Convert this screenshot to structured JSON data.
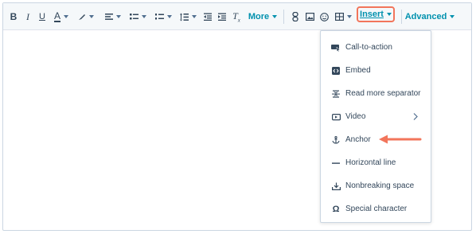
{
  "toolbar": {
    "bold_label": "B",
    "italic_label": "I",
    "underline_label": "U",
    "font_color_label": "A",
    "more_label": "More",
    "insert_label": "Insert",
    "advanced_label": "Advanced"
  },
  "insert_menu": {
    "items": [
      {
        "label": "Call-to-action",
        "icon": "cta-icon"
      },
      {
        "label": "Embed",
        "icon": "embed-icon"
      },
      {
        "label": "Read more separator",
        "icon": "read-more-icon"
      },
      {
        "label": "Video",
        "icon": "video-icon",
        "has_submenu": true
      },
      {
        "label": "Anchor",
        "icon": "anchor-icon"
      },
      {
        "label": "Horizontal line",
        "icon": "horizontal-line-icon"
      },
      {
        "label": "Nonbreaking space",
        "icon": "nonbreaking-space-icon"
      },
      {
        "label": "Special character",
        "icon": "omega-icon"
      }
    ]
  },
  "colors": {
    "accent": "#0091ae",
    "highlight": "#f2755b",
    "text": "#33475b"
  }
}
